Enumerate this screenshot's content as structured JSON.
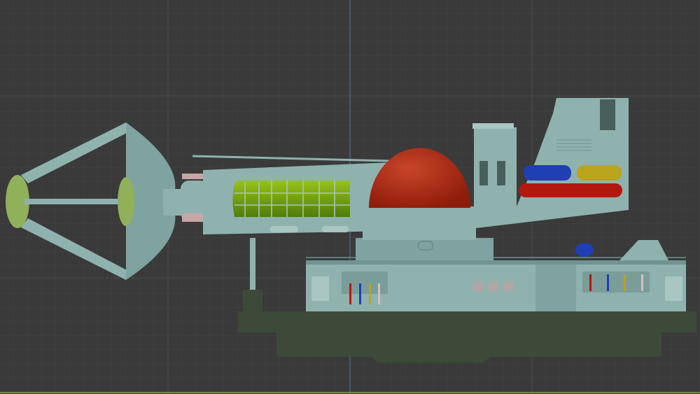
{
  "viewport": {
    "background": "#3a3a3a",
    "grid_minor": "#414141",
    "grid_major": "#4a4a4a",
    "axis_color": "#4f7fa6"
  },
  "model": {
    "hull_color": "#3d4a3a",
    "body_color": "#8fb2af",
    "body_shadow": "#6f9491",
    "dome_color": "#b02a12",
    "cells_color": "#7fae12",
    "tank_colors": [
      "#1f3fb5",
      "#b8a51c",
      "#b3180f"
    ]
  }
}
